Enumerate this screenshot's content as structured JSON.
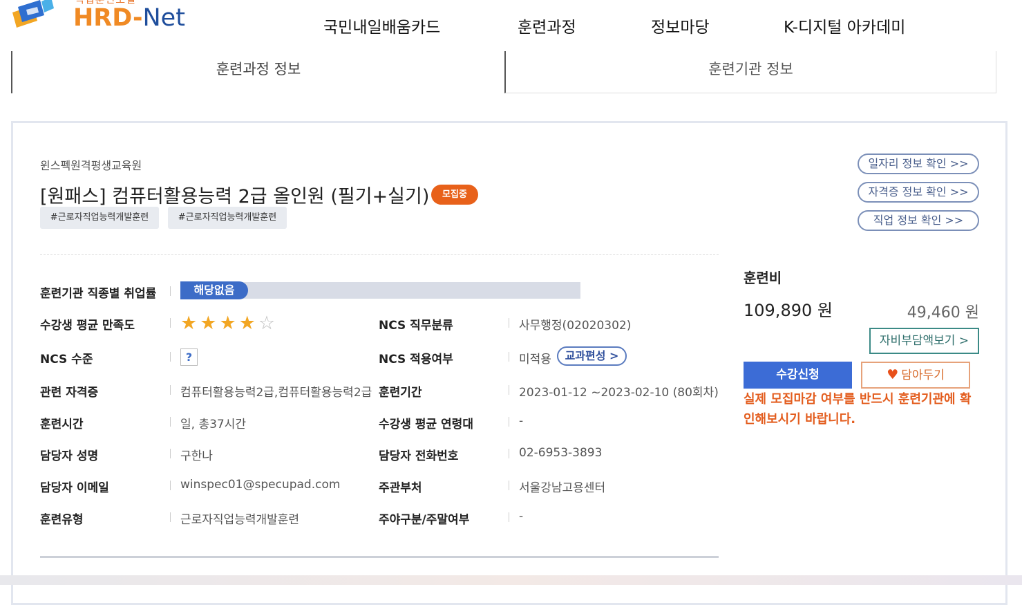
{
  "header": {
    "logo_sub": "직업훈련포털",
    "logo_main": "HRD",
    "logo_dash": "-",
    "logo_net": "Net",
    "nav": [
      "국민내일배움카드",
      "훈련과정",
      "정보마당",
      "K-디지털 아카데미"
    ]
  },
  "tabs": [
    "훈련과정 정보",
    "훈련기관 정보"
  ],
  "course": {
    "institution": "윈스펙원격평생교육원",
    "title": "[원패스] 컴퓨터활용능력 2급 올인원 (필기+실기)",
    "status_badge": "모집중",
    "tags": [
      "#근로자직업능력개발훈련",
      "#근로자직업능력개발훈련"
    ]
  },
  "side_links": [
    "일자리 정보 확인 >>",
    "자격증 정보 확인 >>",
    "직업 정보 확인 >>"
  ],
  "info": {
    "employment_rate_label": "훈련기관 직종별 취업률",
    "employment_rate_value": "해당없음",
    "satisfaction_label": "수강생 평균 만족도",
    "satisfaction_stars": 4,
    "satisfaction_max": 5,
    "ncs_class_label": "NCS 직무분류",
    "ncs_class_value": "사무행정(02020302)",
    "ncs_level_label": "NCS 수준",
    "ncs_level_value": "?",
    "ncs_apply_label": "NCS 적용여부",
    "ncs_apply_value": "미적용",
    "curriculum_button": "교과편성 >",
    "cert_label": "관련 자격증",
    "cert_value": "컴퓨터활용능력2급,컴퓨터활용능력2급",
    "period_label": "훈련기간",
    "period_value": "2023-01-12 ~2023-02-10 (80회차)",
    "hours_label": "훈련시간",
    "hours_value": "일, 총37시간",
    "age_label": "수강생 평균 연령대",
    "age_value": "-",
    "manager_label": "담당자 성명",
    "manager_value": "구한나",
    "phone_label": "담당자 전화번호",
    "phone_value": "02-6953-3893",
    "email_label": "담당자 이메일",
    "email_value": "winspec01@specupad.com",
    "dept_label": "주관부처",
    "dept_value": "서울강남고용센터",
    "type_label": "훈련유형",
    "type_value": "근로자직업능력개발훈련",
    "daynight_label": "주야구분/주말여부",
    "daynight_value": "-"
  },
  "fee": {
    "label": "훈련비",
    "total": "109,890 원",
    "self_pay": "49,460 원",
    "self_pay_button": "자비부담액보기 >",
    "apply_button": "수강신청",
    "wish_button": "담아두기",
    "notice": "실제 모집마감 여부를 반드시 훈련기관에 확인해보시기 바랍니다."
  },
  "colors": {
    "accent_blue": "#3c6cd6",
    "badge_orange": "#e8611a",
    "notice_orange": "#e35d1e",
    "star": "#f2a623"
  }
}
